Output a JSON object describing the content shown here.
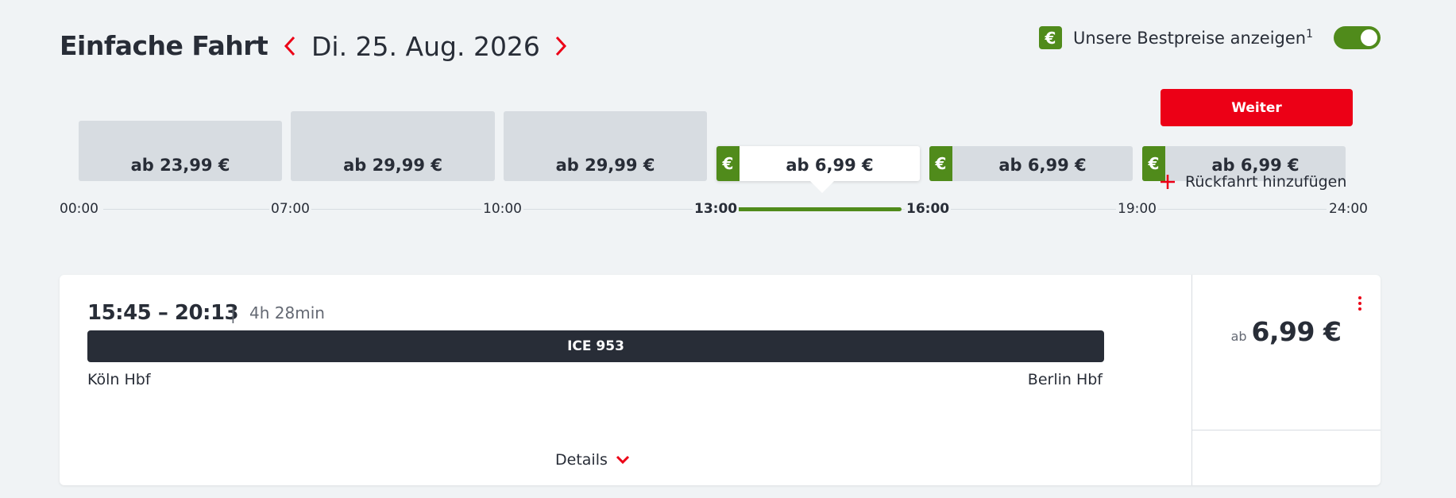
{
  "header": {
    "title": "Einfache Fahrt",
    "date": "Di. 25. Aug. 2026"
  },
  "best_price": {
    "badge": "€",
    "label": "Unsere Bestpreise anzeigen",
    "footnote": "1",
    "enabled": true
  },
  "slots": [
    {
      "price": "ab 23,99 €",
      "best_price": false,
      "selected": false
    },
    {
      "price": "ab 29,99 €",
      "best_price": false,
      "selected": false
    },
    {
      "price": "ab 29,99 €",
      "best_price": false,
      "selected": false
    },
    {
      "price": "ab 6,99 €",
      "best_price": true,
      "selected": true
    },
    {
      "price": "ab 6,99 €",
      "best_price": true,
      "selected": false
    },
    {
      "price": "ab 6,99 €",
      "best_price": true,
      "selected": false
    }
  ],
  "timeline": {
    "ticks": [
      "00:00",
      "07:00",
      "10:00",
      "13:00",
      "16:00",
      "19:00",
      "24:00"
    ],
    "active_range": [
      "13:00",
      "16:00"
    ]
  },
  "connection": {
    "times": "15:45 – 20:13",
    "separator": "|",
    "duration": "4h 28min",
    "train": "ICE 953",
    "from": "Köln Hbf",
    "to": "Berlin Hbf",
    "details_label": "Details",
    "price_prefix": "ab",
    "price": "6,99 €",
    "continue_label": "Weiter",
    "return_label": "Rückfahrt hinzufügen"
  },
  "colors": {
    "accent_red": "#ec0016",
    "best_green": "#508b1b",
    "dark": "#282d37"
  }
}
